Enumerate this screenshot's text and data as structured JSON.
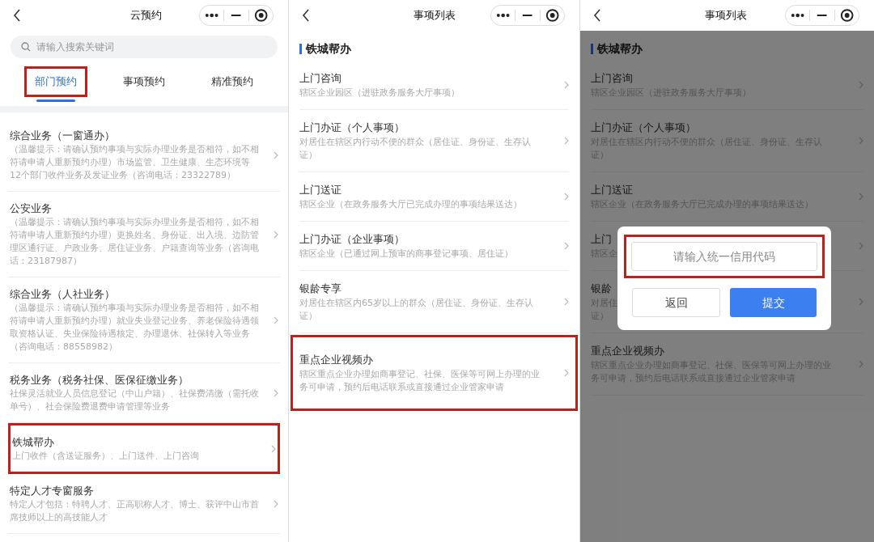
{
  "screens": [
    {
      "title": "云预约",
      "search": {
        "placeholder": "请输入搜索关键词"
      },
      "tabs": [
        {
          "label": "部门预约",
          "selected": true,
          "highlighted": true
        },
        {
          "label": "事项预约",
          "selected": false,
          "highlighted": false
        },
        {
          "label": "精准预约",
          "selected": false,
          "highlighted": false
        }
      ],
      "items": [
        {
          "title": "综合业务（一窗通办）",
          "desc": "（温馨提示：请确认预约事项与实际办理业务是否相符，如不相符请申请人重新预约办理）市场监管、卫生健康、生态环境等12个部门收件业务及发证业务（咨询电话：23322789）",
          "highlighted": false
        },
        {
          "title": "公安业务",
          "desc": "（温馨提示：请确认预约事项与实际办理业务是否相符，如不相符请申请人重新预约办理）更换姓名、身份证、出入境、边防管理区通行证、户政业务、居住证业务、户籍查询等业务（咨询电话：23187987）",
          "highlighted": false
        },
        {
          "title": "综合业务（人社业务）",
          "desc": "（温馨提示：请确认预约事项与实际办理业务是否相符，如不相符请申请人重新预约办理）就业失业登记业务、养老保险待遇领取资格认证、失业保险待遇核定、办理退休、社保转入等业务（咨询电话：88558982）",
          "highlighted": false
        },
        {
          "title": "税务业务（税务社保、医保征缴业务）",
          "desc": "社保灵活就业人员信息登记（中山户籍）、社保费清缴（需托收单号）、社会保险费退费申请管理等业务",
          "highlighted": false
        },
        {
          "title": "铁城帮办",
          "desc": "上门收件（含送证服务）、上门送件、上门咨询",
          "highlighted": true
        },
        {
          "title": "特定人才专窗服务",
          "desc": "特定人才包括：特聘人才、正高职称人才、博士、获评中山市首席技师以上的高技能人才",
          "highlighted": false
        }
      ]
    },
    {
      "title": "事项列表",
      "section": "铁城帮办",
      "items": [
        {
          "title": "上门咨询",
          "desc": "辖区企业园区（进驻政务服务大厅事项）",
          "highlighted": false
        },
        {
          "title": "上门办证（个人事项）",
          "desc": "对居住在辖区内行动不便的群众（居住证、身份证、生存认证）",
          "highlighted": false
        },
        {
          "title": "上门送证",
          "desc": "辖区企业（在政务服务大厅已完成办理的事项结果送达）",
          "highlighted": false
        },
        {
          "title": "上门办证（企业事项）",
          "desc": "辖区企业（已通过网上预审的商事登记事项、居住证）",
          "highlighted": false
        },
        {
          "title": "银龄专享",
          "desc": "对居住在辖区内65岁以上的群众（居住证、身份证、生存认证）",
          "highlighted": false
        },
        {
          "title": "重点企业视频办",
          "desc": "辖区重点企业办理如商事登记、社保、医保等可网上办理的业务可申请，预约后电话联系或直接通过企业管家申请",
          "highlighted": true
        }
      ]
    },
    {
      "title": "事项列表",
      "section": "铁城帮办",
      "dimmed": true,
      "items": [
        {
          "title": "上门咨询",
          "lines": [
            "辖区企业园区（进驻政务服务大厅事项）"
          ]
        },
        {
          "title": "上门办证（个人事项）",
          "lines": [
            "对居住在辖区内行动不便的群众（居住证、身份证、生存认",
            "证）"
          ]
        },
        {
          "title": "上门送证",
          "lines": [
            "辖区企业（在政务服务大厅已完成办理的事项结果送达）"
          ]
        },
        {
          "title": "上门",
          "lines": [
            "辖区企"
          ]
        },
        {
          "title": "银龄",
          "lines": [
            "对居住",
            "证）"
          ]
        },
        {
          "title": "重点企业视频办",
          "lines": [
            "辖区重点企业办理如商事登记、社保、医保等可网上办理的业",
            "务可申请，预约后电话联系或直接通过企业管家申请"
          ]
        }
      ],
      "dialog": {
        "field": {
          "placeholder": "请输入统一信用代码",
          "highlighted": true
        },
        "buttons": [
          {
            "label": "返回",
            "kind": "secondary"
          },
          {
            "label": "提交",
            "kind": "primary"
          }
        ]
      }
    }
  ]
}
